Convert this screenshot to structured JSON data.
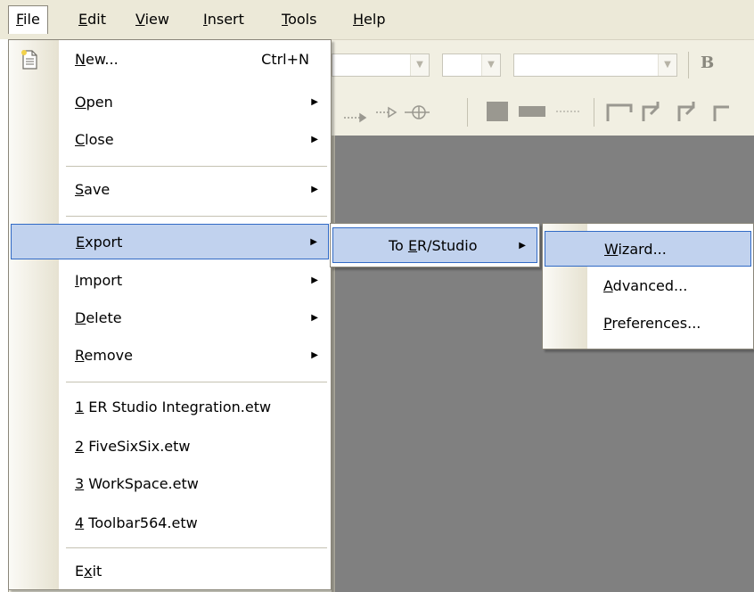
{
  "menubar": {
    "items": [
      {
        "label": "File",
        "ul": "F",
        "rest": "ile"
      },
      {
        "label": "Edit",
        "ul": "E",
        "rest": "dit"
      },
      {
        "label": "View",
        "ul": "V",
        "rest": "iew"
      },
      {
        "label": "Insert",
        "ul": "I",
        "rest": "nsert"
      },
      {
        "label": "Tools",
        "ul": "T",
        "rest": "ools"
      },
      {
        "label": "Help",
        "ul": "H",
        "rest": "elp"
      }
    ]
  },
  "toolbar": {
    "bold_label": "B"
  },
  "file_menu": {
    "new": {
      "ul": "N",
      "rest": "ew...",
      "shortcut": "Ctrl+N"
    },
    "open": {
      "ul": "O",
      "rest": "pen"
    },
    "close": {
      "ul": "C",
      "rest": "lose"
    },
    "save": {
      "ul": "S",
      "rest": "ave"
    },
    "export": {
      "ul": "E",
      "rest": "xport"
    },
    "import": {
      "ul": "I",
      "rest": "mport"
    },
    "delete": {
      "ul": "D",
      "rest": "elete"
    },
    "remove": {
      "ul": "R",
      "rest": "emove"
    },
    "recent": [
      {
        "ul": "1",
        "rest": " ER Studio Integration.etw"
      },
      {
        "ul": "2",
        "rest": " FiveSixSix.etw"
      },
      {
        "ul": "3",
        "rest": " WorkSpace.etw"
      },
      {
        "ul": "4",
        "rest": " Toolbar564.etw"
      }
    ],
    "exit": {
      "pre": "E",
      "ul": "x",
      "rest": "it"
    }
  },
  "export_menu": {
    "to_er_studio": {
      "pre": "To ",
      "ul": "E",
      "rest": "R/Studio"
    }
  },
  "to_er_studio_menu": {
    "wizard": {
      "ul": "W",
      "rest": "izard..."
    },
    "advanced": {
      "ul": "A",
      "rest": "dvanced..."
    },
    "preferences": {
      "ul": "P",
      "rest": "references..."
    }
  },
  "colors": {
    "highlight_fill": "#c1d2ee",
    "highlight_border": "#316ac5",
    "workspace": "#808080"
  }
}
